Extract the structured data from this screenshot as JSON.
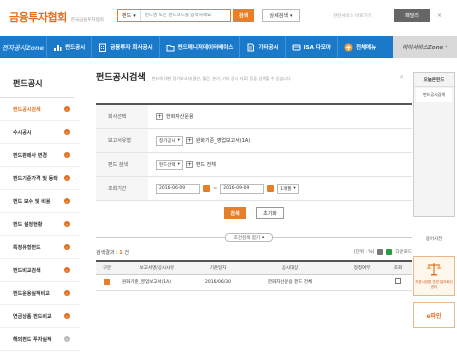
{
  "header": {
    "logo_main": "금융투자협회",
    "logo_sub": "한국금융투자협회",
    "search_category": "펀드",
    "search_placeholder": "펀드명 또는 펀드코드를 입력하세요.",
    "search_button": "검색",
    "advanced_search": "상세검색",
    "service_text": "관련서비스 바로가기",
    "family_site": "패밀리",
    "close": "×"
  },
  "nav": {
    "zone_label": "전자공시Zone",
    "items": [
      {
        "label": "펀드공시",
        "icon": "chart-bars-icon"
      },
      {
        "label": "금융투자 회사공시",
        "icon": "building-icon"
      },
      {
        "label": "펀드매니저데이터베이스",
        "icon": "folder-icon"
      },
      {
        "label": "기타공시",
        "icon": "document-icon"
      },
      {
        "label": "ISA 다모아",
        "icon": "isa-icon"
      },
      {
        "label": "전체메뉴",
        "icon": "plus-circle-icon"
      }
    ],
    "my_zone": "마이서비스Zone"
  },
  "sidebar": {
    "title": "펀드공시",
    "items": [
      {
        "label": "펀드공시검색",
        "active": true
      },
      {
        "label": "수시공시",
        "active": false
      },
      {
        "label": "펀드판매사 변경",
        "active": false
      },
      {
        "label": "펀드기준가격 및 등락",
        "active": false
      },
      {
        "label": "펀드 보수 및 비용",
        "active": false
      },
      {
        "label": "펀드 설정현황",
        "active": false
      },
      {
        "label": "특정유형펀드",
        "active": false
      },
      {
        "label": "펀드비교검색",
        "active": false
      },
      {
        "label": "펀드운용실적비교",
        "active": false
      },
      {
        "label": "연금상품 펀드비교",
        "active": false
      },
      {
        "label": "해외펀드 투자실적",
        "active": false
      }
    ]
  },
  "main": {
    "title": "펀드공시검색",
    "subtitle": "펀드에 대한 정기보고서(결산, 월간, 분기, 기타 공시 자료) 등을 검색할 수 있습니다.",
    "form": {
      "company_label": "회사선택",
      "company_value": "한화자산운용",
      "report_label": "보고서유형",
      "report_select": "정기공시",
      "report_value": "원화기준_영업보고서(1A)",
      "fund_label": "펀드 검색",
      "fund_select": "펀드선택",
      "fund_value": "펀드 전체",
      "period_label": "조회기간",
      "date_from": "2016-06-09",
      "date_sep": "~",
      "date_to": "2016-09-09",
      "period_select": "1개월"
    },
    "search_button": "검색",
    "reset_button": "초기화",
    "fold_button": "조건검색 접기",
    "result_label": "검색결과 :",
    "result_count": "1",
    "result_unit": "건",
    "result_right": "[단위 : %]",
    "download_label": "다운로드",
    "table": {
      "headers": [
        "구분",
        "보고서명/공시사유",
        "기준일자",
        "공시대상",
        "정정여부",
        "조회"
      ],
      "rows": [
        {
          "type": "",
          "name": "원화기준_영업보고서(1A)",
          "date": "2016/06/30",
          "target": "한화자산운용 펀드 전체",
          "amended": "",
          "view": ""
        }
      ]
    }
  },
  "rail": {
    "head": "오늘본펀드",
    "items": [
      "펀드공시검색"
    ],
    "text": "용어사전",
    "banner_label": "자본시장법 관련 질의회신센터",
    "banner2_label": "e파인"
  },
  "colors": {
    "brand": "#e57f2b",
    "nav": "#1a79c9"
  }
}
